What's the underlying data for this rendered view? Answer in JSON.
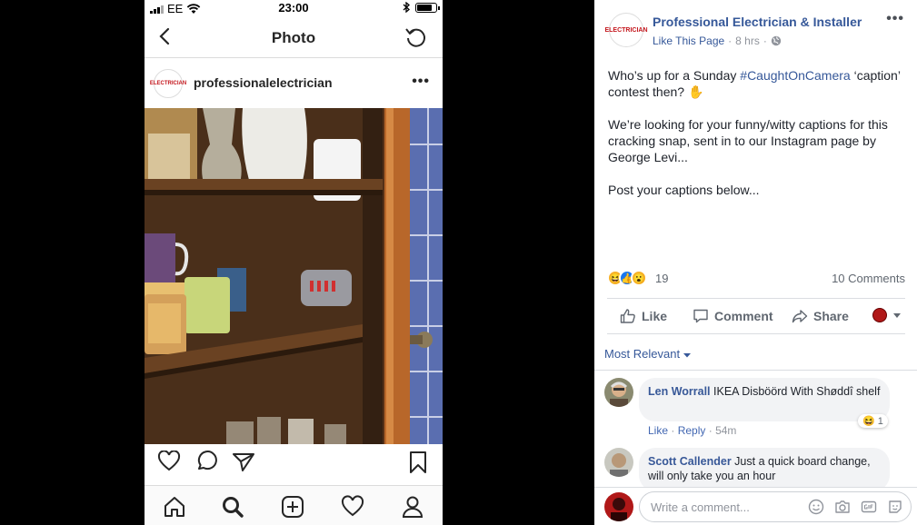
{
  "phone": {
    "status": {
      "carrier": "EE",
      "time": "23:00",
      "battery_level": 0.8
    },
    "nav": {
      "title": "Photo"
    },
    "post": {
      "username": "professionalelectrician",
      "logo_text": "ELECTRICIAN"
    },
    "icons": {
      "back": "back-arrow-icon",
      "refresh": "refresh-icon",
      "more": "more-options-icon",
      "like": "heart-icon",
      "comment": "comment-icon",
      "share": "send-icon",
      "save": "bookmark-icon",
      "tabs": [
        "home-icon",
        "search-icon",
        "add-post-icon",
        "activity-heart-icon",
        "profile-icon"
      ]
    }
  },
  "fb": {
    "page_name": "Professional Electrician & Installer",
    "logo_text": "ELECTRICIAN",
    "like_page": "Like This Page",
    "time": "8 hrs",
    "post": {
      "p1_before": "Who’s up for a Sunday ",
      "hashtag": "#CaughtOnCamera",
      "p1_after": " ‘caption’ contest then? ✋",
      "p2": "We’re looking for your funny/witty captions for this cracking snap, sent in to our Instagram page by George Levi...",
      "p3": "Post your captions below..."
    },
    "reactions": {
      "count": "19",
      "comments": "10 Comments"
    },
    "actions": {
      "like": "Like",
      "comment": "Comment",
      "share": "Share"
    },
    "sort": "Most Relevant",
    "comments": [
      {
        "name": "Len Worrall",
        "text": "IKEA Disböörd With Shøddî shelf",
        "like": "Like",
        "reply": "Reply",
        "time": "54m",
        "reaction_count": "1"
      },
      {
        "name": "Scott Callender",
        "text": "Just a quick board change, will only take you an hour"
      }
    ],
    "write_placeholder": "Write a comment...",
    "colors": {
      "link": "#365899",
      "text": "#1d2129",
      "muted": "#90949c"
    }
  }
}
